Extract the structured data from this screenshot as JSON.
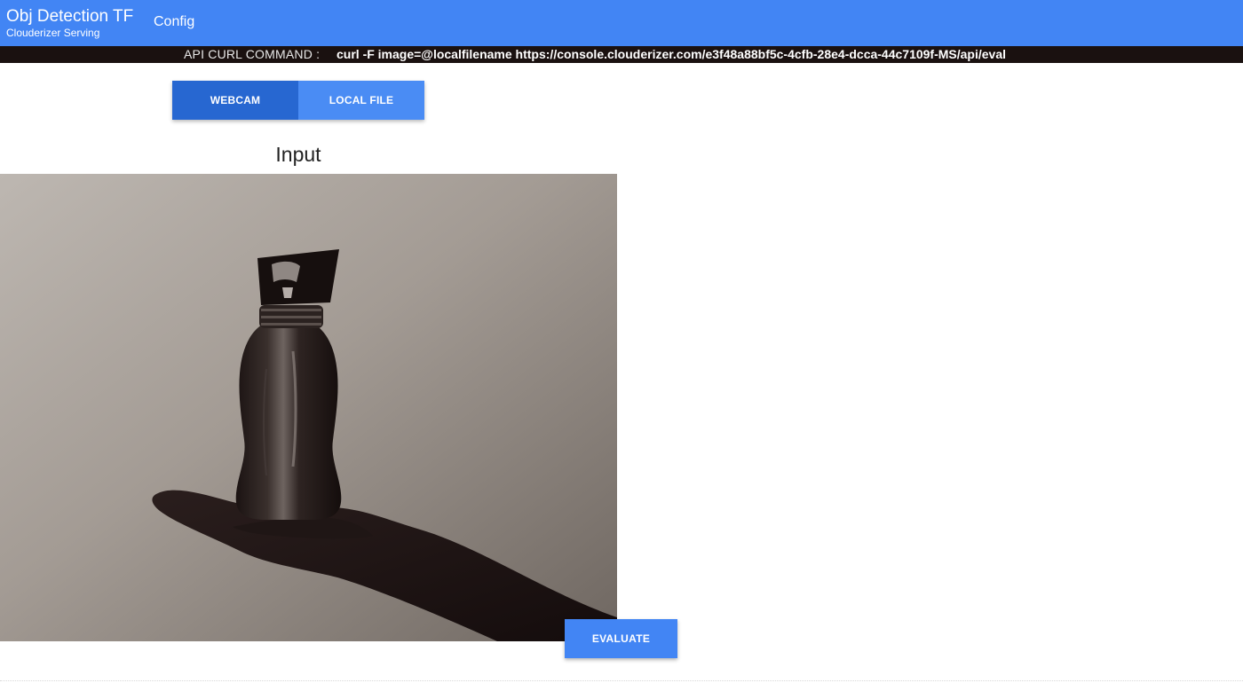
{
  "appbar": {
    "title": "Obj Detection TF",
    "subtitle": "Clouderizer Serving",
    "nav": {
      "config_label": "Config"
    },
    "color": "#4285f4"
  },
  "curl": {
    "label": "API CURL COMMAND :",
    "command": "curl -F image=@localfilename https://console.clouderizer.com/e3f48a88bf5c-4cfb-28e4-dcca-44c7109f-MS/api/eval"
  },
  "source_tabs": [
    {
      "label": "WEBCAM",
      "active": true
    },
    {
      "label": "LOCAL FILE",
      "active": false
    }
  ],
  "input": {
    "title": "Input",
    "image_icon": "bottle-on-hand-photo"
  },
  "actions": {
    "evaluate_label": "EVALUATE"
  },
  "colors": {
    "accent": "#4285f4",
    "accent_dark": "#2767d1",
    "curl_bar": "#1a1110"
  }
}
